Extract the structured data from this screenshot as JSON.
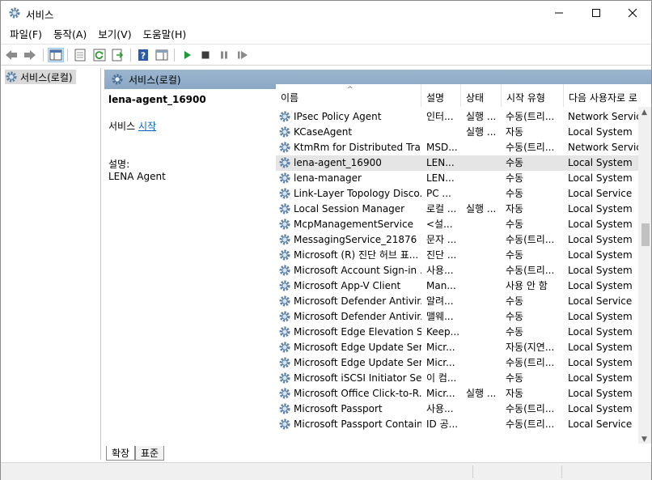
{
  "window": {
    "title": "서비스",
    "controls": [
      "minimize",
      "maximize",
      "close"
    ]
  },
  "menu": [
    "파일(F)",
    "동작(A)",
    "보기(V)",
    "도움말(H)"
  ],
  "toolbar": {
    "icons": [
      "back-icon",
      "forward-icon",
      "show-hide-tree-icon",
      "properties-icon",
      "refresh-icon",
      "export-icon",
      "help-icon",
      "console-tree-icon",
      "start-icon",
      "stop-icon",
      "pause-icon",
      "restart-icon"
    ]
  },
  "tree": {
    "root_label": "서비스(로컬)"
  },
  "pane_header": "서비스(로컬)",
  "detail": {
    "service_name": "lena-agent_16900",
    "action_prefix": "서비스 ",
    "action_link": "시작",
    "desc_label": "설명:",
    "desc_value": "LENA Agent"
  },
  "columns": {
    "name": "이름",
    "desc": "설명",
    "status": "상태",
    "startup": "시작 유형",
    "logon": "다음 사용자로 로"
  },
  "services": [
    {
      "name": "IPsec Policy Agent",
      "desc": "인터...",
      "status": "실행 ...",
      "startup": "수동(트리...",
      "logon": "Network Service"
    },
    {
      "name": "KCaseAgent",
      "desc": "",
      "status": "실행 ...",
      "startup": "자동",
      "logon": "Local System"
    },
    {
      "name": "KtmRm for Distributed Tra...",
      "desc": "MSD...",
      "status": "",
      "startup": "수동(트리...",
      "logon": "Network Service"
    },
    {
      "name": "lena-agent_16900",
      "desc": "LEN...",
      "status": "",
      "startup": "수동",
      "logon": "Local System",
      "selected": true
    },
    {
      "name": "lena-manager",
      "desc": "LEN...",
      "status": "",
      "startup": "수동",
      "logon": "Local System"
    },
    {
      "name": "Link-Layer Topology Disco...",
      "desc": "PC ...",
      "status": "",
      "startup": "수동",
      "logon": "Local Service"
    },
    {
      "name": "Local Session Manager",
      "desc": "로컬 ...",
      "status": "실행 ...",
      "startup": "자동",
      "logon": "Local System"
    },
    {
      "name": "McpManagementService",
      "desc": "<설...",
      "status": "",
      "startup": "수동",
      "logon": "Local System"
    },
    {
      "name": "MessagingService_21876",
      "desc": "문자 ...",
      "status": "",
      "startup": "수동(트리...",
      "logon": "Local System"
    },
    {
      "name": "Microsoft (R) 진단 허브 표...",
      "desc": "진단 ...",
      "status": "",
      "startup": "수동",
      "logon": "Local System"
    },
    {
      "name": "Microsoft Account Sign-in ...",
      "desc": "사용...",
      "status": "",
      "startup": "수동(트리...",
      "logon": "Local System"
    },
    {
      "name": "Microsoft App-V Client",
      "desc": "Man...",
      "status": "",
      "startup": "사용 안 함",
      "logon": "Local System"
    },
    {
      "name": "Microsoft Defender Antivir...",
      "desc": "알려...",
      "status": "",
      "startup": "수동",
      "logon": "Local Service"
    },
    {
      "name": "Microsoft Defender Antivir...",
      "desc": "맬웨...",
      "status": "",
      "startup": "수동",
      "logon": "Local System"
    },
    {
      "name": "Microsoft Edge Elevation S...",
      "desc": "Keep...",
      "status": "",
      "startup": "수동",
      "logon": "Local System"
    },
    {
      "name": "Microsoft Edge Update Ser...",
      "desc": "Micr...",
      "status": "",
      "startup": "자동(지연...",
      "logon": "Local System"
    },
    {
      "name": "Microsoft Edge Update Ser...",
      "desc": "Micr...",
      "status": "",
      "startup": "수동(트리...",
      "logon": "Local System"
    },
    {
      "name": "Microsoft iSCSI Initiator Se...",
      "desc": "이 컴...",
      "status": "",
      "startup": "수동",
      "logon": "Local System"
    },
    {
      "name": "Microsoft Office Click-to-R...",
      "desc": "Micr...",
      "status": "실행 ...",
      "startup": "자동",
      "logon": "Local System"
    },
    {
      "name": "Microsoft Passport",
      "desc": "사용...",
      "status": "",
      "startup": "수동(트리...",
      "logon": "Local System"
    },
    {
      "name": "Microsoft Passport Container",
      "desc": "ID 공...",
      "status": "",
      "startup": "수동(트리...",
      "logon": "Local Service"
    }
  ],
  "tabs": [
    "확장",
    "표준"
  ]
}
